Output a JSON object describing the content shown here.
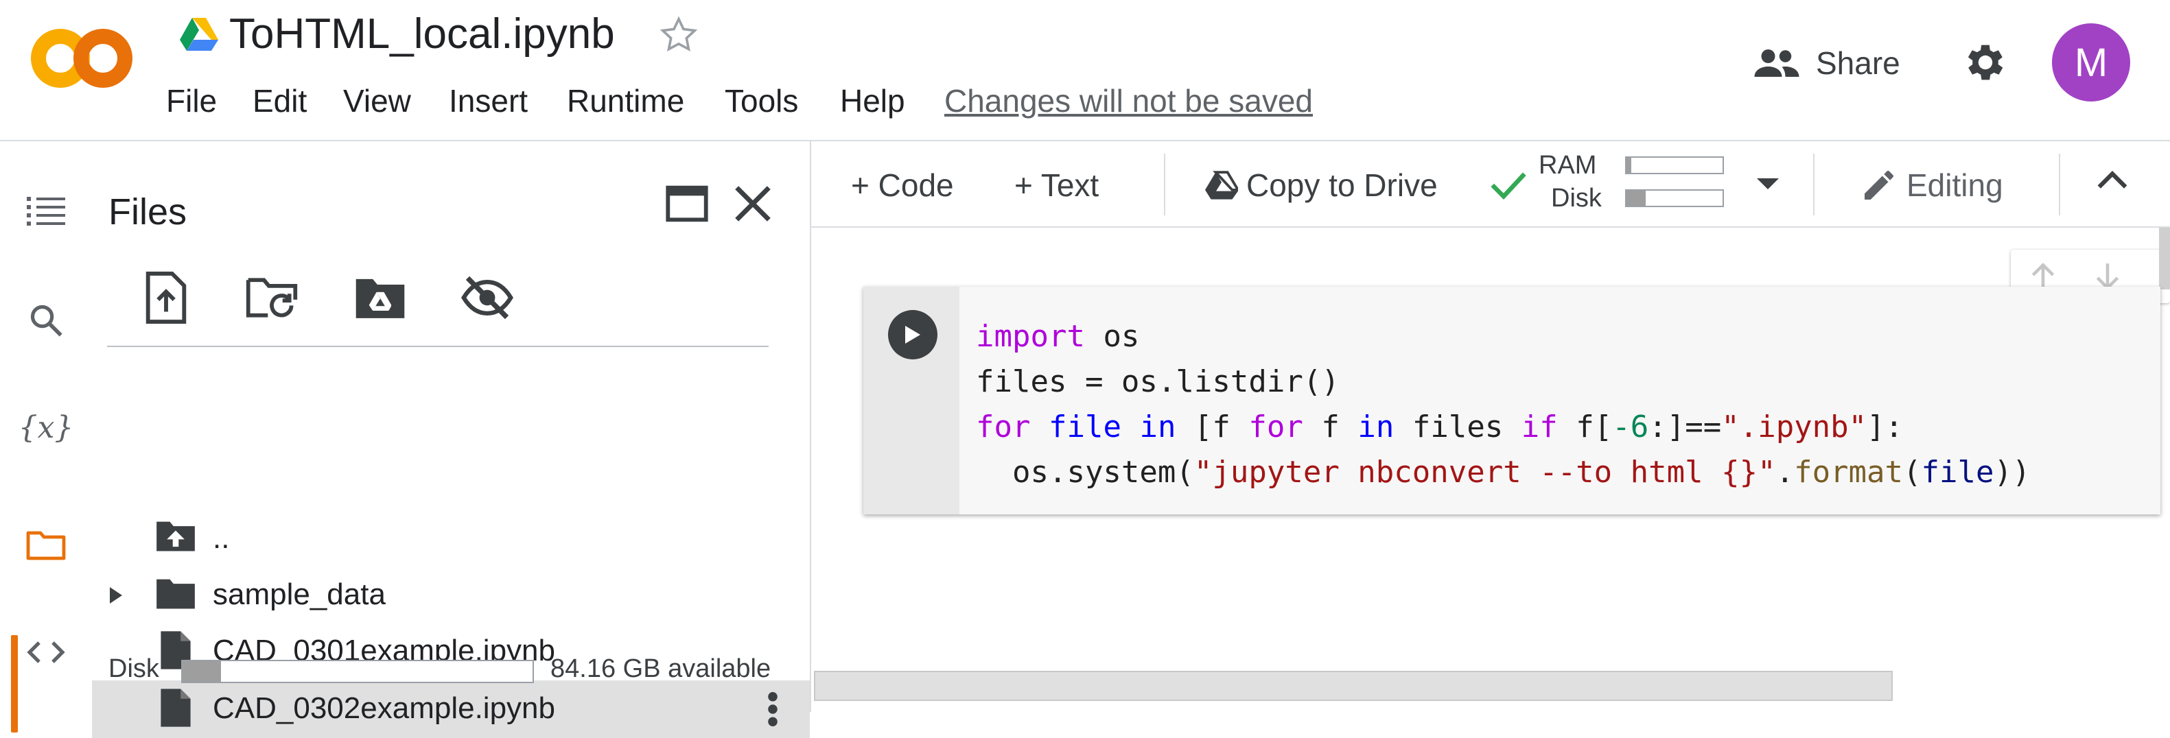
{
  "app": {
    "logo_text": "CO",
    "title": "ToHTML_local.ipynb",
    "menu": [
      "File",
      "Edit",
      "View",
      "Insert",
      "Runtime",
      "Tools",
      "Help"
    ],
    "unsaved_notice": "Changes will not be saved",
    "share_label": "Share",
    "avatar_letter": "M"
  },
  "rail": {
    "icons": [
      "table-of-contents-icon",
      "search-icon",
      "variables-icon",
      "files-icon",
      "code-snippets-icon"
    ],
    "active": "files-icon",
    "variables_glyph": "{x}"
  },
  "files_panel": {
    "title": "Files",
    "items": [
      {
        "name": "..",
        "type": "parent"
      },
      {
        "name": "sample_data",
        "type": "folder"
      },
      {
        "name": "CAD_0301example.ipynb",
        "type": "file"
      },
      {
        "name": "CAD_0302example.ipynb",
        "type": "file",
        "selected": true
      }
    ],
    "disk": {
      "label": "Disk",
      "available": "84.16 GB available",
      "used_fraction": 0.11
    }
  },
  "toolbar": {
    "add_code": "+ Code",
    "add_text": "+ Text",
    "copy_to_drive": "Copy to Drive",
    "ram_label": "RAM",
    "disk_label": "Disk",
    "ram_used_fraction": 0.05,
    "disk_used_fraction": 0.2,
    "editing_label": "Editing"
  },
  "cell": {
    "code_lines": [
      "import os",
      "files = os.listdir()",
      "for file in [f for f in files if f[-6:]==\".ipynb\"]:",
      "  os.system(\"jupyter nbconvert --to html {}\".format(file))"
    ]
  },
  "colors": {
    "accent_orange": "#e8710a",
    "avatar": "#a142c4",
    "connected_check": "#34a853"
  }
}
